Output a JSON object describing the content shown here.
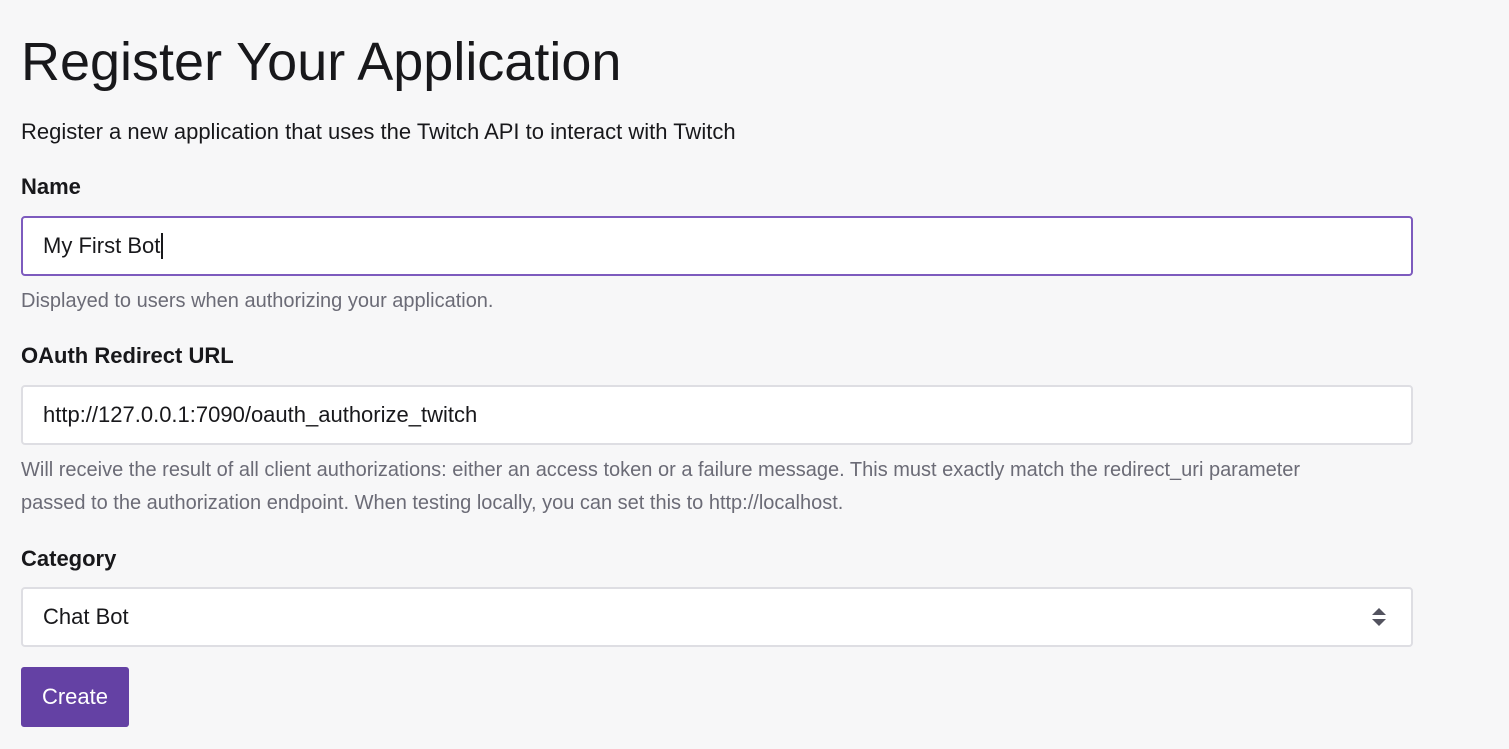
{
  "page": {
    "title": "Register Your Application",
    "subtitle": "Register a new application that uses the Twitch API to interact with Twitch"
  },
  "form": {
    "name": {
      "label": "Name",
      "value": "My First Bot",
      "help": "Displayed to users when authorizing your application."
    },
    "redirect_url": {
      "label": "OAuth Redirect URL",
      "value": "http://127.0.0.1:7090/oauth_authorize_twitch",
      "help": "Will receive the result of all client authorizations: either an access token or a failure message. This must exactly match the redirect_uri parameter passed to the authorization endpoint. When testing locally, you can set this to http://localhost."
    },
    "category": {
      "label": "Category",
      "selected": "Chat Bot",
      "icon": "select-arrows-icon"
    },
    "submit_label": "Create"
  },
  "colors": {
    "accent": "#6441a4",
    "focus_border": "#7d5bbe",
    "background": "#f7f7f8",
    "help_text": "#6b6b76"
  }
}
